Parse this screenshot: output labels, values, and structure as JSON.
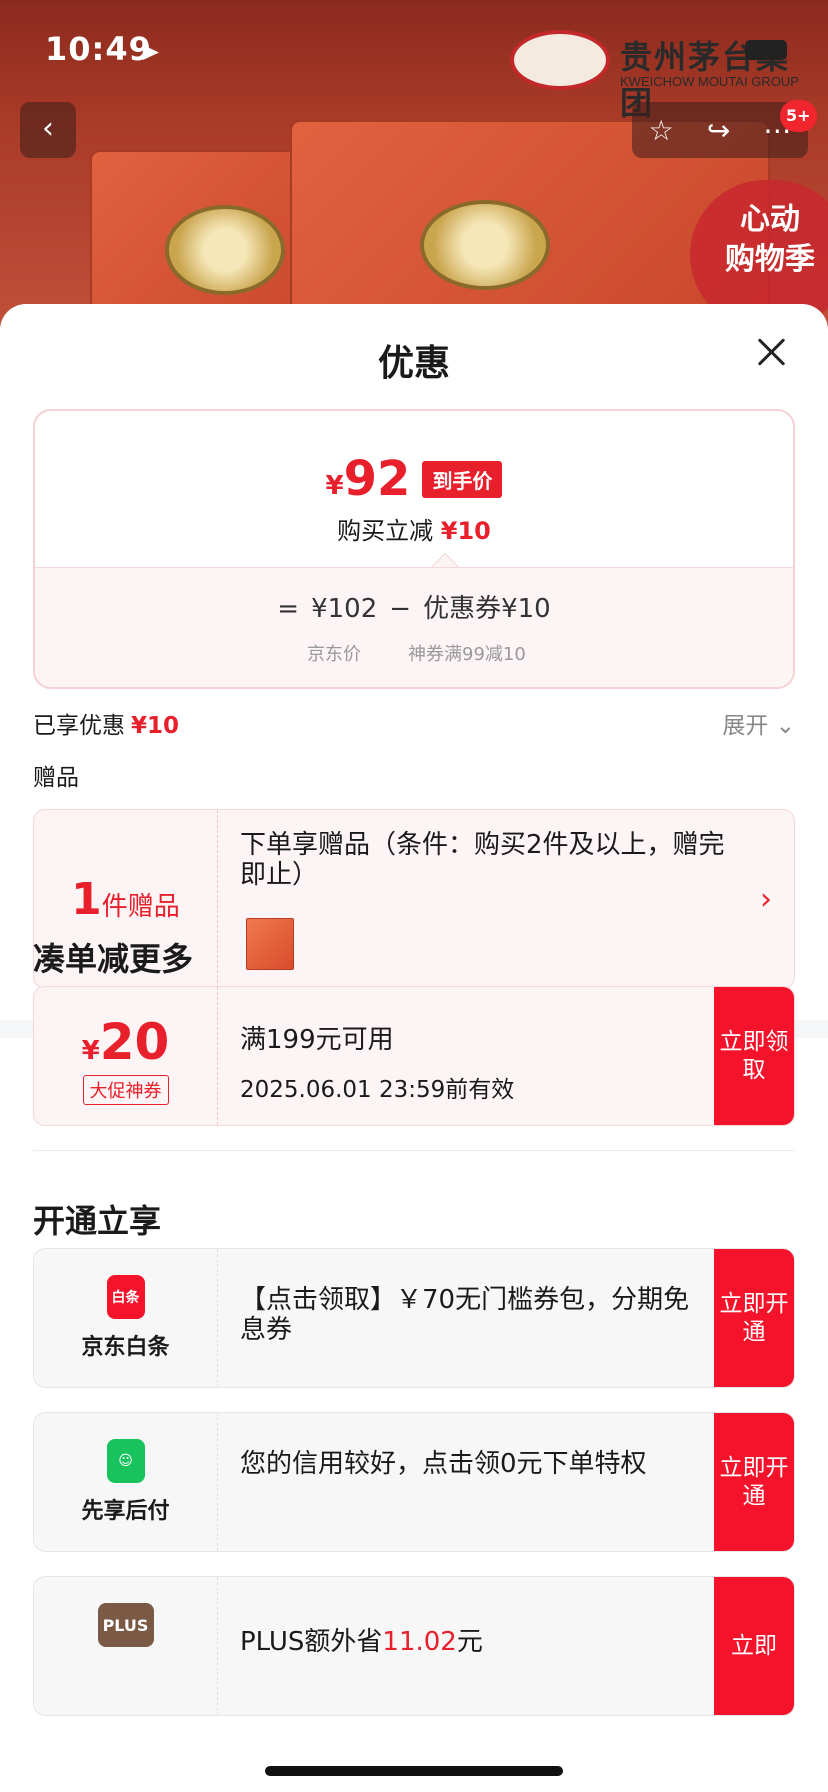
{
  "status_bar": {
    "time": "10:49",
    "location_icon": "location-arrow-icon"
  },
  "background": {
    "brand_cn": "贵州茅台集团",
    "brand_en": "KWEICHOW MOUTAI GROUP",
    "badge_count": "5+",
    "promo_text_1": "心动",
    "promo_text_2": "购物季",
    "icons": [
      "back-icon",
      "star-icon",
      "share-icon",
      "more-icon"
    ]
  },
  "sheet": {
    "title": "优惠",
    "price_card": {
      "currency": "¥",
      "price": "92",
      "price_tag": "到手价",
      "instant_label": "购买立减",
      "instant_value": "¥10",
      "eq": "=",
      "jd_price": "¥102",
      "minus": "−",
      "coupon_part": "优惠券¥10",
      "jd_price_label": "京东价",
      "coupon_desc": "神券满99减10"
    },
    "enjoyed_label": "已享优惠",
    "enjoyed_value": "¥10",
    "expand_label": "展开",
    "gift_heading": "赠品",
    "gift": {
      "count": "1",
      "unit": "件赠品",
      "text": "下单享赠品（条件：购买2件及以上，赠完即止）"
    },
    "more_discount_heading": "凑单减更多",
    "coupon": {
      "currency": "¥",
      "amount": "20",
      "label": "大促神券",
      "condition": "满199元可用",
      "expiry": "2025.06.01 23:59前有效",
      "button": "立即领取"
    },
    "activate_heading": "开通立享",
    "services": [
      {
        "icon_text": "白条",
        "name": "京东白条",
        "text": "【点击领取】￥70无门槛券包，分期免息券",
        "button": "立即开通",
        "color": "#f5132b"
      },
      {
        "icon_text": "",
        "name": "先享后付",
        "text": "您的信用较好，点击领0元下单特权",
        "button": "立即开通",
        "color": "#18c35e"
      },
      {
        "icon_text": "PLUS",
        "name": "",
        "text_prefix": "PLUS额外省",
        "text_value": "11.02",
        "text_suffix": "元",
        "button": "立即",
        "color": "#7b5a45"
      }
    ]
  }
}
